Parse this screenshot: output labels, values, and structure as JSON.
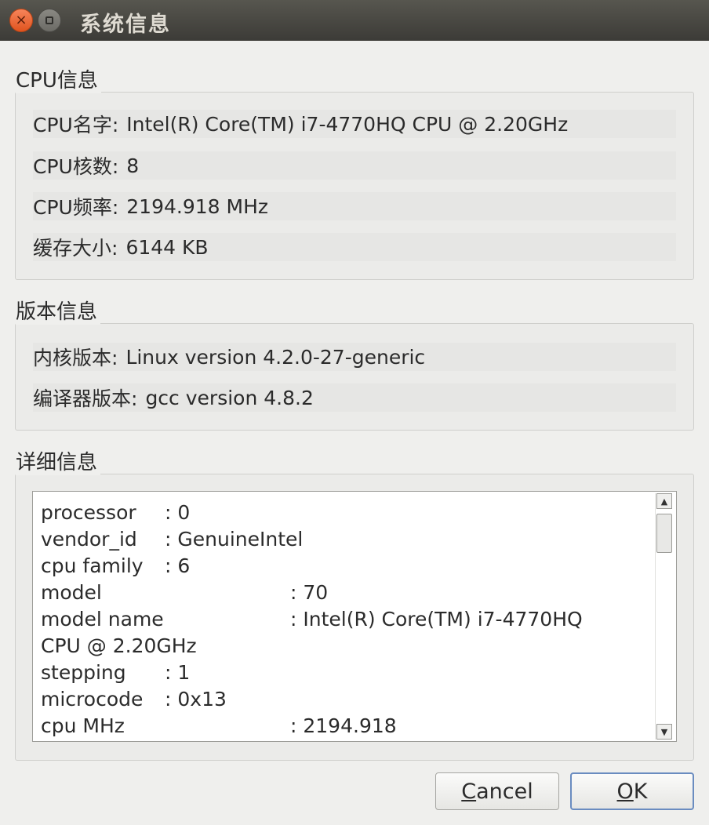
{
  "window": {
    "title": "系统信息"
  },
  "cpu": {
    "section": "CPU信息",
    "rows": [
      {
        "label": "CPU名字:",
        "value": "Intel(R) Core(TM) i7-4770HQ CPU @ 2.20GHz"
      },
      {
        "label": "CPU核数:",
        "value": "8"
      },
      {
        "label": "CPU频率:",
        "value": "2194.918 MHz"
      },
      {
        "label": "缓存大小:",
        "value": "6144 KB"
      }
    ]
  },
  "version": {
    "section": "版本信息",
    "rows": [
      {
        "label": "内核版本:",
        "value": "Linux version 4.2.0-27-generic"
      },
      {
        "label": "编译器版本:",
        "value": "gcc version 4.8.2"
      }
    ]
  },
  "detail": {
    "section": "详细信息",
    "lines": [
      {
        "key": "processor",
        "value": ": 0",
        "wide": false
      },
      {
        "key": "vendor_id",
        "value": ": GenuineIntel",
        "wide": false
      },
      {
        "key": "cpu family",
        "value": ": 6",
        "wide": false
      },
      {
        "key": "model",
        "value": ": 70",
        "wide": true
      },
      {
        "key": "model name",
        "value": ": Intel(R) Core(TM) i7-4770HQ",
        "wide": true
      },
      {
        "key": "CPU @ 2.20GHz",
        "value": "",
        "wide": false
      },
      {
        "key": "stepping",
        "value": ": 1",
        "wide": false
      },
      {
        "key": "microcode",
        "value": ": 0x13",
        "wide": false
      },
      {
        "key": "cpu MHz",
        "value": ": 2194.918",
        "wide": true
      }
    ]
  },
  "buttons": {
    "cancel_first": "C",
    "cancel_rest": "ancel",
    "ok_first": "O",
    "ok_rest": "K"
  }
}
